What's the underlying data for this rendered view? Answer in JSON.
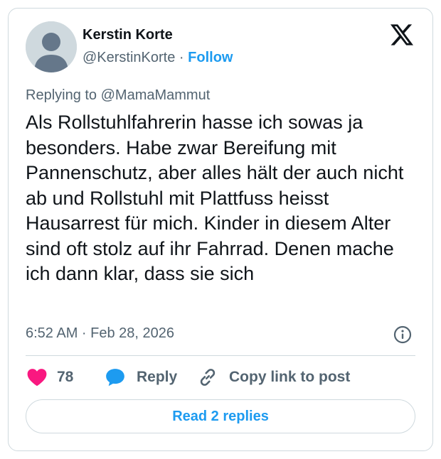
{
  "author": {
    "name": "Kerstin Korte",
    "handle": "@KerstinKorte",
    "separator": "·",
    "follow_label": "Follow"
  },
  "reply_context": "Replying to @MamaMammut",
  "tweet_text": "Als Rollstuhlfahrerin hasse ich sowas ja besonders. Habe zwar Bereifung mit Pannenschutz, aber alles hält der auch nicht ab und Rollstuhl mit Plattfuss heisst Hausarrest für mich. Kinder in diesem Alter sind oft stolz auf ihr Fahrrad. Denen mache ich dann klar, dass sie sich",
  "timestamp": "6:52 AM · Feb 28, 2026",
  "actions": {
    "like_count": "78",
    "reply_label": "Reply",
    "copy_label": "Copy link to post"
  },
  "read_replies_label": "Read 2 replies",
  "icons": {
    "logo": "x-logo-icon",
    "info": "info-icon",
    "like": "heart-icon",
    "reply": "speech-bubble-icon",
    "copy": "link-icon"
  },
  "colors": {
    "accent": "#1d9bf0",
    "like": "#f91880",
    "secondary_text": "#536471",
    "border": "#cfd9de"
  }
}
